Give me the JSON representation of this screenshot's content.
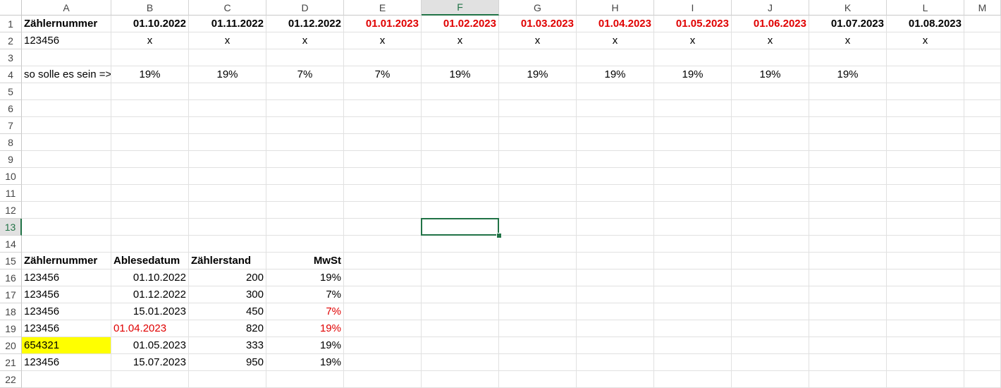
{
  "sheet": {
    "columns": [
      "A",
      "B",
      "C",
      "D",
      "E",
      "F",
      "G",
      "H",
      "I",
      "J",
      "K",
      "L",
      "M"
    ],
    "rows": [
      "1",
      "2",
      "3",
      "4",
      "5",
      "6",
      "7",
      "8",
      "9",
      "10",
      "11",
      "12",
      "13",
      "14",
      "15",
      "16",
      "17",
      "18",
      "19",
      "20",
      "21",
      "22"
    ],
    "selected_column": "F",
    "selected_row": "13",
    "active_cell": "F13",
    "colors": {
      "accent": "#217346",
      "red_text": "#e00000",
      "highlight": "#ffff00"
    },
    "cells": [
      {
        "ref": "A1",
        "text": "Zählernummer",
        "align": "left",
        "bold": true
      },
      {
        "ref": "B1",
        "text": "01.10.2022",
        "align": "right",
        "bold": true
      },
      {
        "ref": "C1",
        "text": "01.11.2022",
        "align": "right",
        "bold": true
      },
      {
        "ref": "D1",
        "text": "01.12.2022",
        "align": "right",
        "bold": true
      },
      {
        "ref": "E1",
        "text": "01.01.2023",
        "align": "right",
        "bold": true,
        "red": true
      },
      {
        "ref": "F1",
        "text": "01.02.2023",
        "align": "right",
        "bold": true,
        "red": true
      },
      {
        "ref": "G1",
        "text": "01.03.2023",
        "align": "right",
        "bold": true,
        "red": true
      },
      {
        "ref": "H1",
        "text": "01.04.2023",
        "align": "right",
        "bold": true,
        "red": true
      },
      {
        "ref": "I1",
        "text": "01.05.2023",
        "align": "right",
        "bold": true,
        "red": true
      },
      {
        "ref": "J1",
        "text": "01.06.2023",
        "align": "right",
        "bold": true,
        "red": true
      },
      {
        "ref": "K1",
        "text": "01.07.2023",
        "align": "right",
        "bold": true
      },
      {
        "ref": "L1",
        "text": "01.08.2023",
        "align": "right",
        "bold": true
      },
      {
        "ref": "A2",
        "text": "123456",
        "align": "left"
      },
      {
        "ref": "B2",
        "text": "x",
        "align": "center"
      },
      {
        "ref": "C2",
        "text": "x",
        "align": "center"
      },
      {
        "ref": "D2",
        "text": "x",
        "align": "center"
      },
      {
        "ref": "E2",
        "text": "x",
        "align": "center"
      },
      {
        "ref": "F2",
        "text": "x",
        "align": "center"
      },
      {
        "ref": "G2",
        "text": "x",
        "align": "center"
      },
      {
        "ref": "H2",
        "text": "x",
        "align": "center"
      },
      {
        "ref": "I2",
        "text": "x",
        "align": "center"
      },
      {
        "ref": "J2",
        "text": "x",
        "align": "center"
      },
      {
        "ref": "K2",
        "text": "x",
        "align": "center"
      },
      {
        "ref": "L2",
        "text": "x",
        "align": "center"
      },
      {
        "ref": "A4",
        "text": "so solle es sein =>",
        "align": "left",
        "clip": true
      },
      {
        "ref": "B4",
        "text": "19%",
        "align": "center"
      },
      {
        "ref": "C4",
        "text": "19%",
        "align": "center"
      },
      {
        "ref": "D4",
        "text": "7%",
        "align": "center"
      },
      {
        "ref": "E4",
        "text": "7%",
        "align": "center"
      },
      {
        "ref": "F4",
        "text": "19%",
        "align": "center"
      },
      {
        "ref": "G4",
        "text": "19%",
        "align": "center"
      },
      {
        "ref": "H4",
        "text": "19%",
        "align": "center"
      },
      {
        "ref": "I4",
        "text": "19%",
        "align": "center"
      },
      {
        "ref": "J4",
        "text": "19%",
        "align": "center"
      },
      {
        "ref": "K4",
        "text": "19%",
        "align": "center"
      },
      {
        "ref": "A15",
        "text": "Zählernummer",
        "align": "left",
        "bold": true
      },
      {
        "ref": "B15",
        "text": "Ablesedatum",
        "align": "left",
        "bold": true
      },
      {
        "ref": "C15",
        "text": "Zählerstand",
        "align": "left",
        "bold": true
      },
      {
        "ref": "D15",
        "text": "MwSt",
        "align": "right",
        "bold": true
      },
      {
        "ref": "A16",
        "text": "123456",
        "align": "left"
      },
      {
        "ref": "B16",
        "text": "01.10.2022",
        "align": "right"
      },
      {
        "ref": "C16",
        "text": "200",
        "align": "right"
      },
      {
        "ref": "D16",
        "text": "19%",
        "align": "right"
      },
      {
        "ref": "A17",
        "text": "123456",
        "align": "left"
      },
      {
        "ref": "B17",
        "text": "01.12.2022",
        "align": "right"
      },
      {
        "ref": "C17",
        "text": "300",
        "align": "right"
      },
      {
        "ref": "D17",
        "text": "7%",
        "align": "right"
      },
      {
        "ref": "A18",
        "text": "123456",
        "align": "left"
      },
      {
        "ref": "B18",
        "text": "15.01.2023",
        "align": "right"
      },
      {
        "ref": "C18",
        "text": "450",
        "align": "right"
      },
      {
        "ref": "D18",
        "text": "7%",
        "align": "right",
        "red": true
      },
      {
        "ref": "A19",
        "text": "123456",
        "align": "left"
      },
      {
        "ref": "B19",
        "text": "01.04.2023",
        "align": "left",
        "red": true
      },
      {
        "ref": "C19",
        "text": "820",
        "align": "right"
      },
      {
        "ref": "D19",
        "text": "19%",
        "align": "right",
        "red": true
      },
      {
        "ref": "A20",
        "text": "654321",
        "align": "left",
        "yellow": true
      },
      {
        "ref": "B20",
        "text": "01.05.2023",
        "align": "right"
      },
      {
        "ref": "C20",
        "text": "333",
        "align": "right"
      },
      {
        "ref": "D20",
        "text": "19%",
        "align": "right"
      },
      {
        "ref": "A21",
        "text": "123456",
        "align": "left"
      },
      {
        "ref": "B21",
        "text": "15.07.2023",
        "align": "right"
      },
      {
        "ref": "C21",
        "text": "950",
        "align": "right"
      },
      {
        "ref": "D21",
        "text": "19%",
        "align": "right"
      }
    ]
  }
}
